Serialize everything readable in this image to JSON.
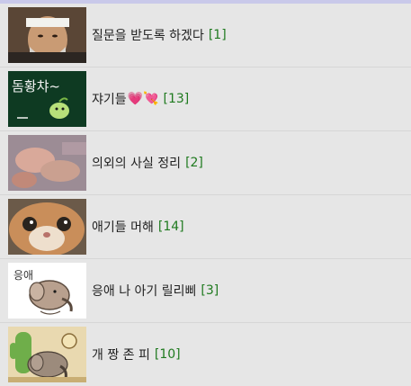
{
  "items": [
    {
      "title": "질문을 받도록 하겠다",
      "emoji": "",
      "count": "[1]"
    },
    {
      "title": "쟈기들",
      "emoji": "💗💘",
      "count": "[13]"
    },
    {
      "title": "의외의 사실 정리",
      "emoji": "",
      "count": "[2]"
    },
    {
      "title": "애기들 머해",
      "emoji": "",
      "count": "[14]"
    },
    {
      "title": "응애 나 아기 릴리삐",
      "emoji": "",
      "count": "[3]"
    },
    {
      "title": "개 짱 존 피",
      "emoji": "",
      "count": "[10]"
    }
  ],
  "thumb_texts": {
    "sign": "돔황챠~",
    "elephant": "응애"
  },
  "colors": {
    "count": "#1f7a1f",
    "topbar": "#c9c9ea",
    "background": "#e6e6e6"
  }
}
